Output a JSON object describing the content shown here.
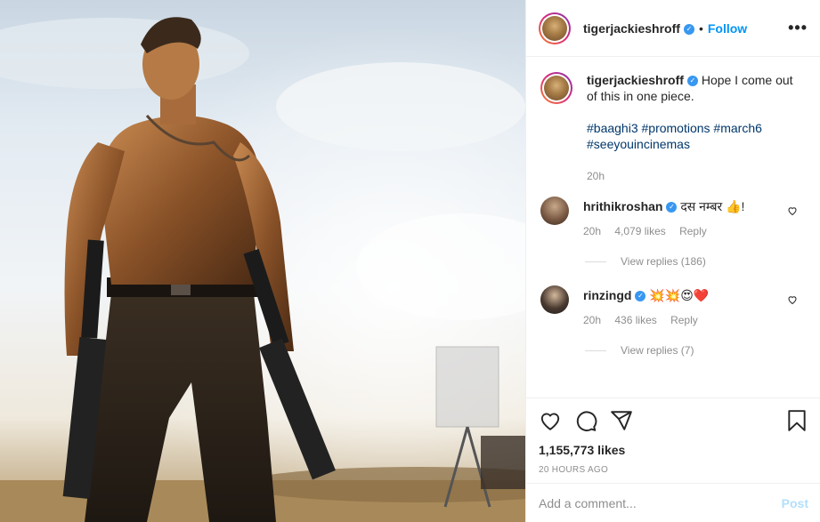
{
  "post": {
    "username": "tigerjackieshroff",
    "follow_label": "Follow",
    "separator": "•",
    "more_icon": "more-options-icon",
    "verified_icon": "verified-badge-icon"
  },
  "caption": {
    "username": "tigerjackieshroff",
    "text": "Hope I come out of this in one piece.",
    "hashtags_line1": "#baaghi3 #promotions #march6",
    "hashtags_line2": "#seeyouincinemas",
    "time": "20h"
  },
  "comments": [
    {
      "username": "hrithikroshan",
      "text": "दस नम्बर 👍!",
      "time": "20h",
      "likes": "4,079 likes",
      "reply_label": "Reply",
      "view_replies": "View replies (186)"
    },
    {
      "username": "rinzingd",
      "text": "💥💥😍❤️",
      "time": "20h",
      "likes": "436 likes",
      "reply_label": "Reply",
      "view_replies": "View replies (7)"
    }
  ],
  "actions": {
    "like_icon": "heart-icon",
    "comment_icon": "comment-icon",
    "share_icon": "share-icon",
    "save_icon": "bookmark-icon",
    "likes_count": "1,155,773 likes",
    "posted_ago": "20 HOURS AGO"
  },
  "add_comment": {
    "placeholder": "Add a comment...",
    "post_label": "Post"
  },
  "colors": {
    "accent": "#0095f6",
    "verified": "#3897f0",
    "muted": "#8e8e8e",
    "post_disabled": "#b2dffc"
  }
}
